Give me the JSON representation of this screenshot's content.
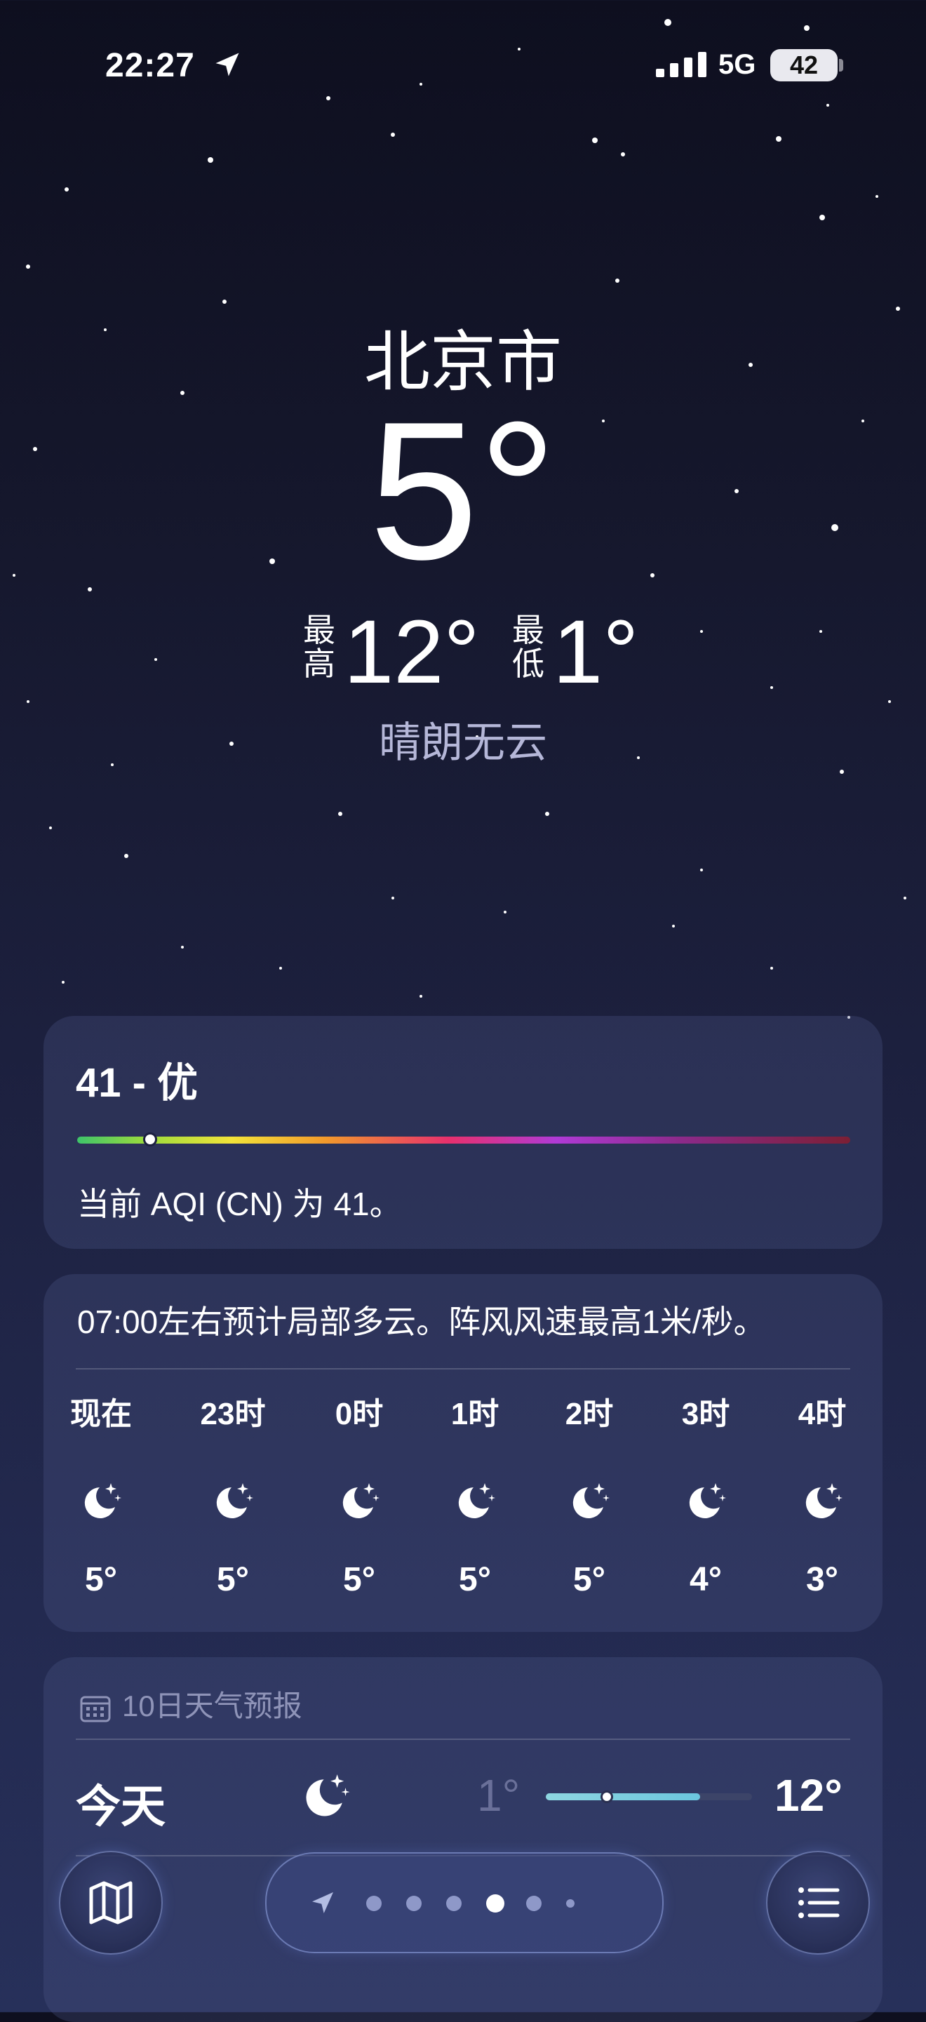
{
  "status_bar": {
    "time": "22:27",
    "network": "5G",
    "battery": "42",
    "location_icon": "location-arrow-icon",
    "signal_icon": "cellular-signal-icon"
  },
  "hero": {
    "city": "北京市",
    "temperature": "5°",
    "high_label": "最高",
    "high_value": "12°",
    "low_label": "最低",
    "low_value": "1°",
    "condition": "晴朗无云"
  },
  "aqi": {
    "value": "41 - 优",
    "description": "当前 AQI (CN) 为 41。",
    "level_fraction": 0.09
  },
  "hourly": {
    "summary": "07:00左右预计局部多云。阵风风速最高1米/秒。",
    "hours": [
      {
        "label": "现在",
        "icon": "moon-stars-icon",
        "temp": "5°"
      },
      {
        "label": "23时",
        "icon": "moon-stars-icon",
        "temp": "5°"
      },
      {
        "label": "0时",
        "icon": "moon-stars-icon",
        "temp": "5°"
      },
      {
        "label": "1时",
        "icon": "moon-stars-icon",
        "temp": "5°"
      },
      {
        "label": "2时",
        "icon": "moon-stars-icon",
        "temp": "5°"
      },
      {
        "label": "3时",
        "icon": "moon-stars-icon",
        "temp": "4°"
      },
      {
        "label": "4时",
        "icon": "moon-stars-icon",
        "temp": "3°"
      }
    ]
  },
  "forecast": {
    "header": "10日天气预报",
    "header_icon": "calendar-icon",
    "days": [
      {
        "day": "今天",
        "icon": "moon-stars-icon",
        "low": "1°",
        "high": "12°",
        "current_fraction": 0.27
      }
    ]
  },
  "toolbar": {
    "map_icon": "map-icon",
    "list_icon": "list-icon",
    "page_count": 7,
    "active_page": 4
  },
  "colors": {
    "aqi_good": "#3ec46a",
    "temp_bar": "#6bc6de",
    "condition_text": "#b5b7d8"
  }
}
